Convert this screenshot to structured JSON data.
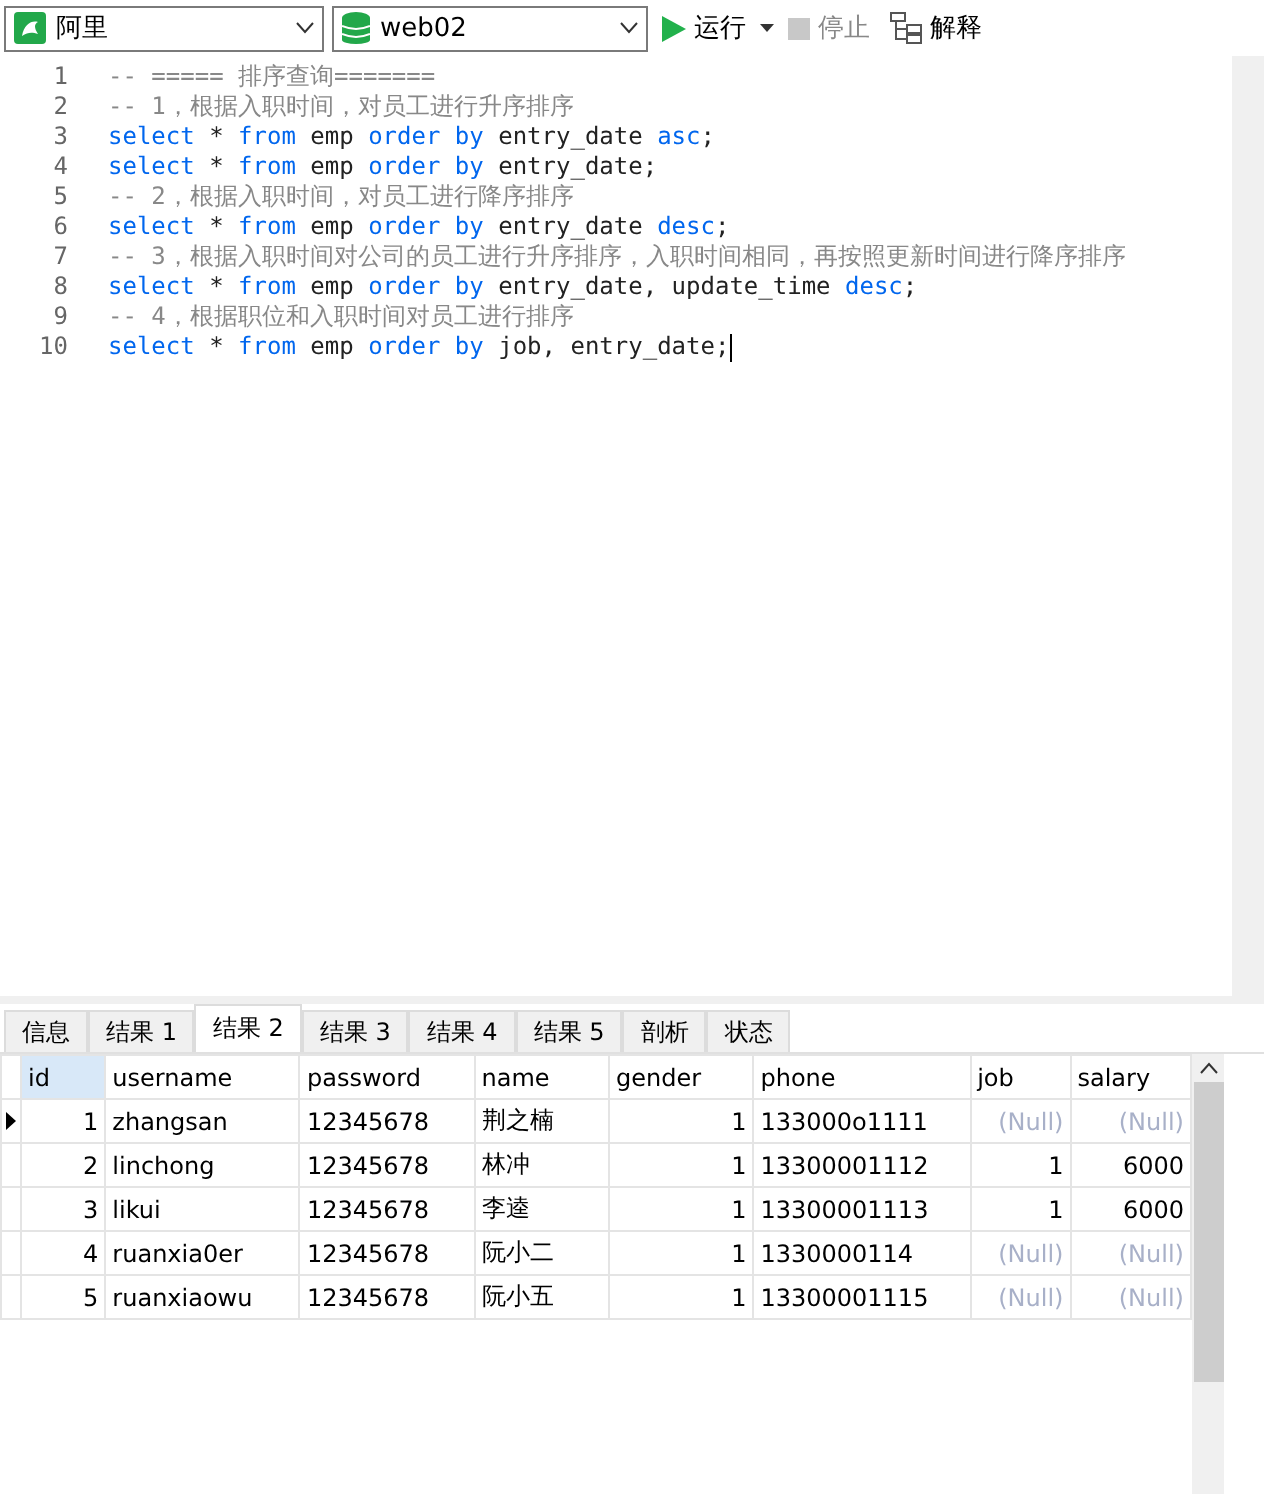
{
  "toolbar": {
    "connection": "阿里",
    "database": "web02",
    "buttons": [
      {
        "kind": "run",
        "label": "运行",
        "disabled": false
      },
      {
        "kind": "stop",
        "label": "停止",
        "disabled": true
      },
      {
        "kind": "explain",
        "label": "解释",
        "disabled": false
      }
    ]
  },
  "editor": {
    "lines": [
      {
        "number": "1",
        "tokens": [
          {
            "kind": "comment",
            "text": "-- ===== 排序查询======="
          }
        ]
      },
      {
        "number": "2",
        "tokens": [
          {
            "kind": "comment",
            "text": "-- 1，根据入职时间，对员工进行升序排序"
          }
        ]
      },
      {
        "number": "3",
        "tokens": [
          {
            "kind": "keyword",
            "text": "select"
          },
          {
            "kind": "plain",
            "text": " * "
          },
          {
            "kind": "keyword",
            "text": "from"
          },
          {
            "kind": "plain",
            "text": " emp "
          },
          {
            "kind": "keyword",
            "text": "order by"
          },
          {
            "kind": "plain",
            "text": " entry_date "
          },
          {
            "kind": "keyword",
            "text": "asc"
          },
          {
            "kind": "plain",
            "text": ";"
          }
        ]
      },
      {
        "number": "4",
        "tokens": [
          {
            "kind": "keyword",
            "text": "select"
          },
          {
            "kind": "plain",
            "text": " * "
          },
          {
            "kind": "keyword",
            "text": "from"
          },
          {
            "kind": "plain",
            "text": " emp "
          },
          {
            "kind": "keyword",
            "text": "order by"
          },
          {
            "kind": "plain",
            "text": " entry_date;"
          }
        ]
      },
      {
        "number": "5",
        "tokens": [
          {
            "kind": "comment",
            "text": "-- 2，根据入职时间，对员工进行降序排序"
          }
        ]
      },
      {
        "number": "6",
        "tokens": [
          {
            "kind": "keyword",
            "text": "select"
          },
          {
            "kind": "plain",
            "text": " * "
          },
          {
            "kind": "keyword",
            "text": "from"
          },
          {
            "kind": "plain",
            "text": " emp "
          },
          {
            "kind": "keyword",
            "text": "order by"
          },
          {
            "kind": "plain",
            "text": " entry_date "
          },
          {
            "kind": "keyword",
            "text": "desc"
          },
          {
            "kind": "plain",
            "text": ";"
          }
        ]
      },
      {
        "number": "7",
        "tokens": [
          {
            "kind": "comment",
            "text": "-- 3，根据入职时间对公司的员工进行升序排序，入职时间相同，再按照更新时间进行降序排序"
          }
        ]
      },
      {
        "number": "8",
        "tokens": [
          {
            "kind": "keyword",
            "text": "select"
          },
          {
            "kind": "plain",
            "text": " * "
          },
          {
            "kind": "keyword",
            "text": "from"
          },
          {
            "kind": "plain",
            "text": " emp "
          },
          {
            "kind": "keyword",
            "text": "order by"
          },
          {
            "kind": "plain",
            "text": " entry_date, update_time "
          },
          {
            "kind": "keyword",
            "text": "desc"
          },
          {
            "kind": "plain",
            "text": ";"
          }
        ]
      },
      {
        "number": "9",
        "tokens": [
          {
            "kind": "comment",
            "text": "-- 4，根据职位和入职时间对员工进行排序"
          }
        ]
      },
      {
        "number": "10",
        "cursor": true,
        "tokens": [
          {
            "kind": "keyword",
            "text": "select"
          },
          {
            "kind": "plain",
            "text": " * "
          },
          {
            "kind": "keyword",
            "text": "from"
          },
          {
            "kind": "plain",
            "text": " emp "
          },
          {
            "kind": "keyword",
            "text": "order by"
          },
          {
            "kind": "plain",
            "text": " job, entry_date;"
          }
        ]
      }
    ]
  },
  "result_tabs": [
    {
      "label": "信息",
      "selected": false
    },
    {
      "label": "结果 1",
      "selected": false
    },
    {
      "label": "结果 2",
      "selected": true
    },
    {
      "label": "结果 3",
      "selected": false
    },
    {
      "label": "结果 4",
      "selected": false
    },
    {
      "label": "结果 5",
      "selected": false
    },
    {
      "label": "剖析",
      "selected": false
    },
    {
      "label": "状态",
      "selected": false
    }
  ],
  "table": {
    "columns": [
      {
        "label": "id",
        "kind": "number",
        "selected": true
      },
      {
        "label": "username",
        "kind": "text",
        "selected": false
      },
      {
        "label": "password",
        "kind": "text",
        "selected": false
      },
      {
        "label": "name",
        "kind": "text",
        "selected": false
      },
      {
        "label": "gender",
        "kind": "number",
        "selected": false
      },
      {
        "label": "phone",
        "kind": "text",
        "selected": false
      },
      {
        "label": "job",
        "kind": "number",
        "selected": false
      },
      {
        "label": "salary",
        "kind": "number",
        "selected": false
      }
    ],
    "rows": [
      {
        "current": true,
        "cells": [
          "1",
          "zhangsan",
          "12345678",
          "荆之楠",
          "1",
          "133000o1111",
          {
            "text": "(Null)",
            "null": true
          },
          {
            "text": "(Null)",
            "null": true
          }
        ]
      },
      {
        "current": false,
        "cells": [
          "2",
          "linchong",
          "12345678",
          "林冲",
          "1",
          "13300001112",
          "1",
          "6000"
        ]
      },
      {
        "current": false,
        "cells": [
          "3",
          "likui",
          "12345678",
          "李逵",
          "1",
          "13300001113",
          "1",
          "6000"
        ]
      },
      {
        "current": false,
        "cells": [
          "4",
          "ruanxia0er",
          "12345678",
          "阮小二",
          "1",
          "1330000114",
          {
            "text": "(Null)",
            "null": true
          },
          {
            "text": "(Null)",
            "null": true
          }
        ]
      },
      {
        "current": false,
        "cells": [
          "5",
          "ruanxiaowu",
          "12345678",
          "阮小五",
          "1",
          "13300001115",
          {
            "text": "(Null)",
            "null": true
          },
          {
            "text": "(Null)",
            "null": true
          }
        ]
      }
    ]
  }
}
